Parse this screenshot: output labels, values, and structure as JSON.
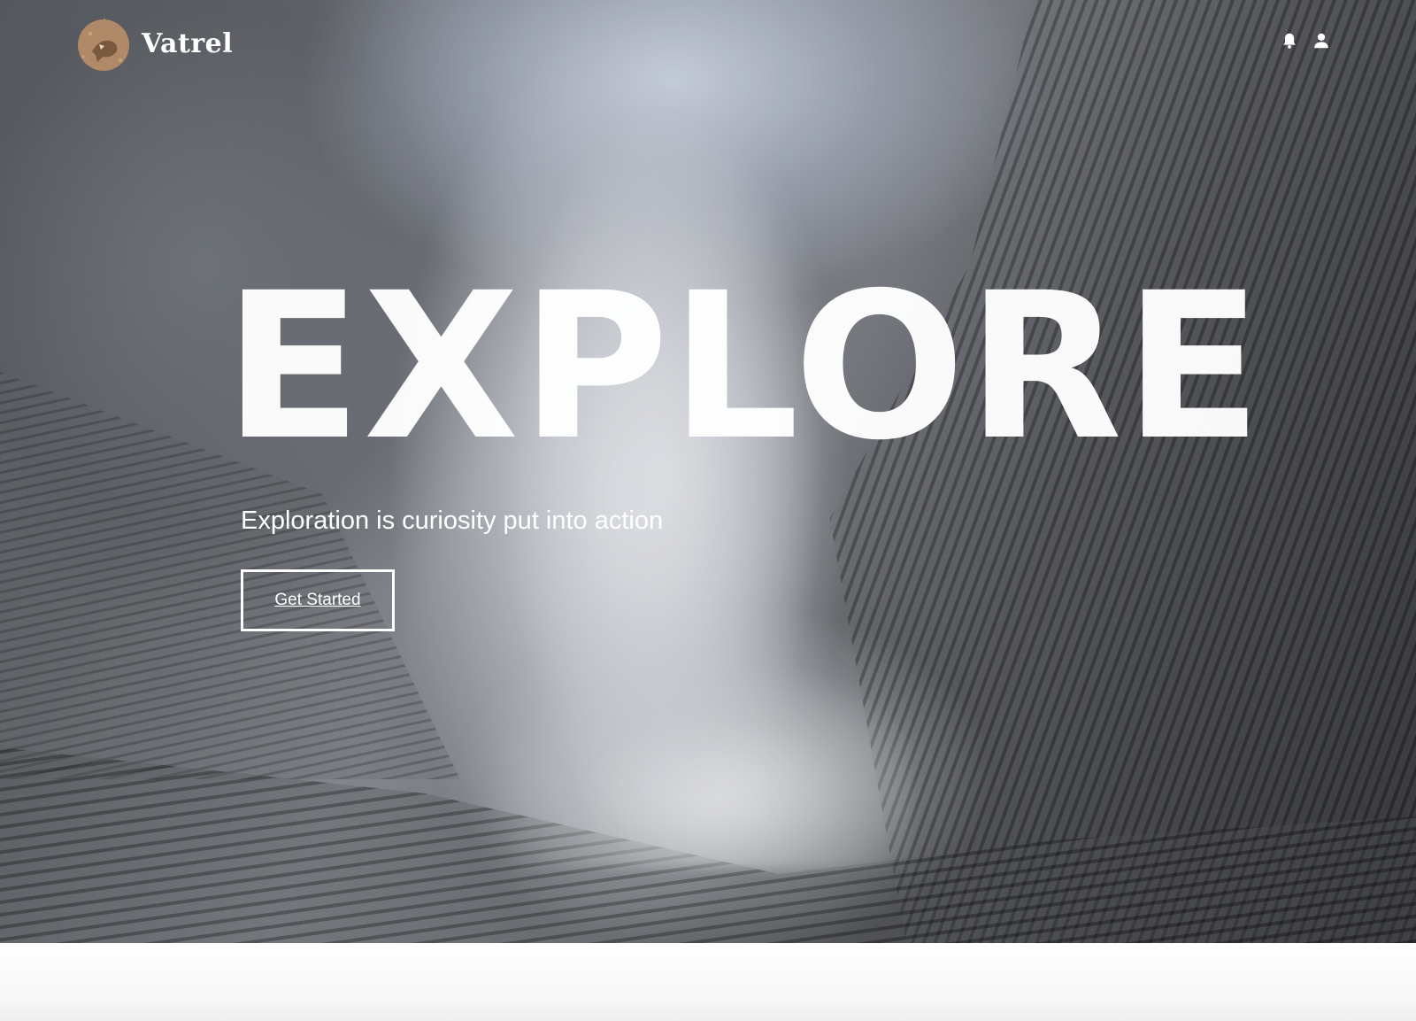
{
  "brand": {
    "name": "Vatrel",
    "logo_icon": "mountain-wolf-logo",
    "logo_color": "#b08968"
  },
  "nav": {
    "icons": [
      "bell-icon",
      "user-icon"
    ]
  },
  "hero": {
    "headline": "EXPLORE",
    "tagline": "Exploration is curiosity put into action",
    "cta_label": "Get Started",
    "background": "volcanic crater with rising steam"
  },
  "colors": {
    "text": "#ffffff",
    "footer_bg": "#f7f7f7"
  }
}
